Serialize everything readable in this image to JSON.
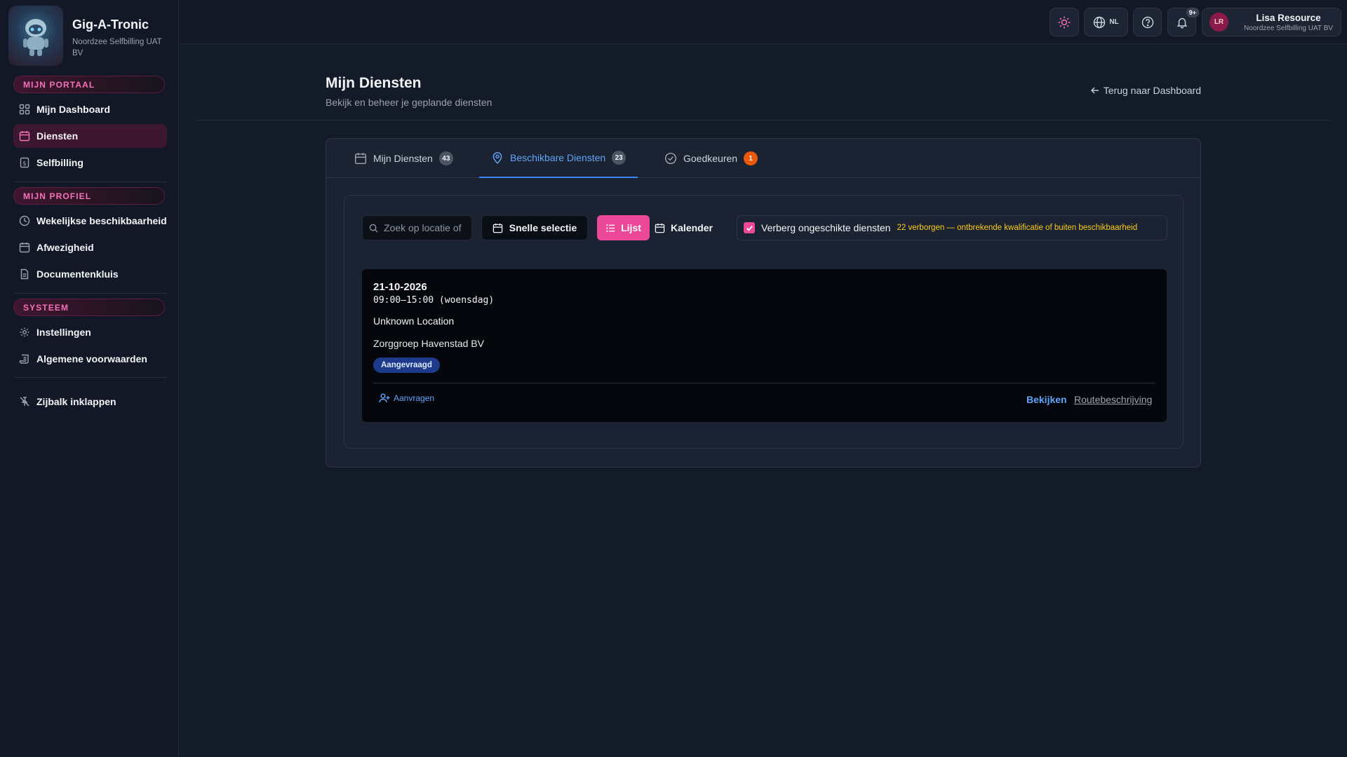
{
  "app": {
    "name": "Gig-A-Tronic",
    "organization": "Noordzee Selfbilling UAT BV"
  },
  "sidebar": {
    "sections": [
      {
        "title": "MIJN PORTAAL"
      },
      {
        "title": "MIJN PROFIEL"
      },
      {
        "title": "SYSTEEM"
      }
    ],
    "items": [
      {
        "label": "Mijn Dashboard",
        "icon": "dashboard-icon"
      },
      {
        "label": "Diensten",
        "icon": "calendar-icon",
        "active": true
      },
      {
        "label": "Selfbilling",
        "icon": "dollar-document-icon"
      },
      {
        "label": "Wekelijkse beschikbaarheid",
        "icon": "clock-icon"
      },
      {
        "label": "Afwezigheid",
        "icon": "calendar-icon"
      },
      {
        "label": "Documentenkluis",
        "icon": "document-icon"
      },
      {
        "label": "Instellingen",
        "icon": "gear-icon"
      },
      {
        "label": "Algemene voorwaarden",
        "icon": "scroll-icon"
      },
      {
        "label": "Zijbalk inklappen",
        "icon": "pin-off-icon"
      }
    ]
  },
  "topbar": {
    "language": "NL",
    "notification_badge": "9+",
    "user": {
      "initials": "LR",
      "name": "Lisa Resource",
      "organization": "Noordzee Selfbilling UAT BV"
    }
  },
  "page": {
    "title": "Mijn Diensten",
    "subtitle": "Bekijk en beheer je geplande diensten",
    "back_link": "Terug naar Dashboard"
  },
  "tabs": [
    {
      "label": "Mijn Diensten",
      "count": "43",
      "active": false
    },
    {
      "label": "Beschikbare Diensten",
      "count": "23",
      "active": true
    },
    {
      "label": "Goedkeuren",
      "count": "1",
      "active": false
    }
  ],
  "toolbar": {
    "search_placeholder": "Zoek op locatie of",
    "quick_select": "Snelle selectie",
    "list_view": "Lijst",
    "calendar_view": "Kalender",
    "hide_unsuitable_label": "Verberg ongeschikte diensten",
    "hide_unsuitable_checked": true,
    "hidden_note": "22 verborgen — ontbrekende kwalificatie of buiten beschikbaarheid"
  },
  "shifts": [
    {
      "date": "21-10-2026",
      "time": "09:00–15:00 (woensdag)",
      "location": "Unknown Location",
      "organization": "Zorggroep Havenstad BV",
      "status": "Aangevraagd",
      "request_label": "Aanvragen",
      "view_label": "Bekijken",
      "route_label": "Routebeschrijving"
    }
  ],
  "colors": {
    "accent_pink": "#ec4899",
    "accent_blue": "#3b82f6",
    "background": "#131a28",
    "warning_yellow": "#facc15",
    "badge_orange": "#ea580c"
  }
}
